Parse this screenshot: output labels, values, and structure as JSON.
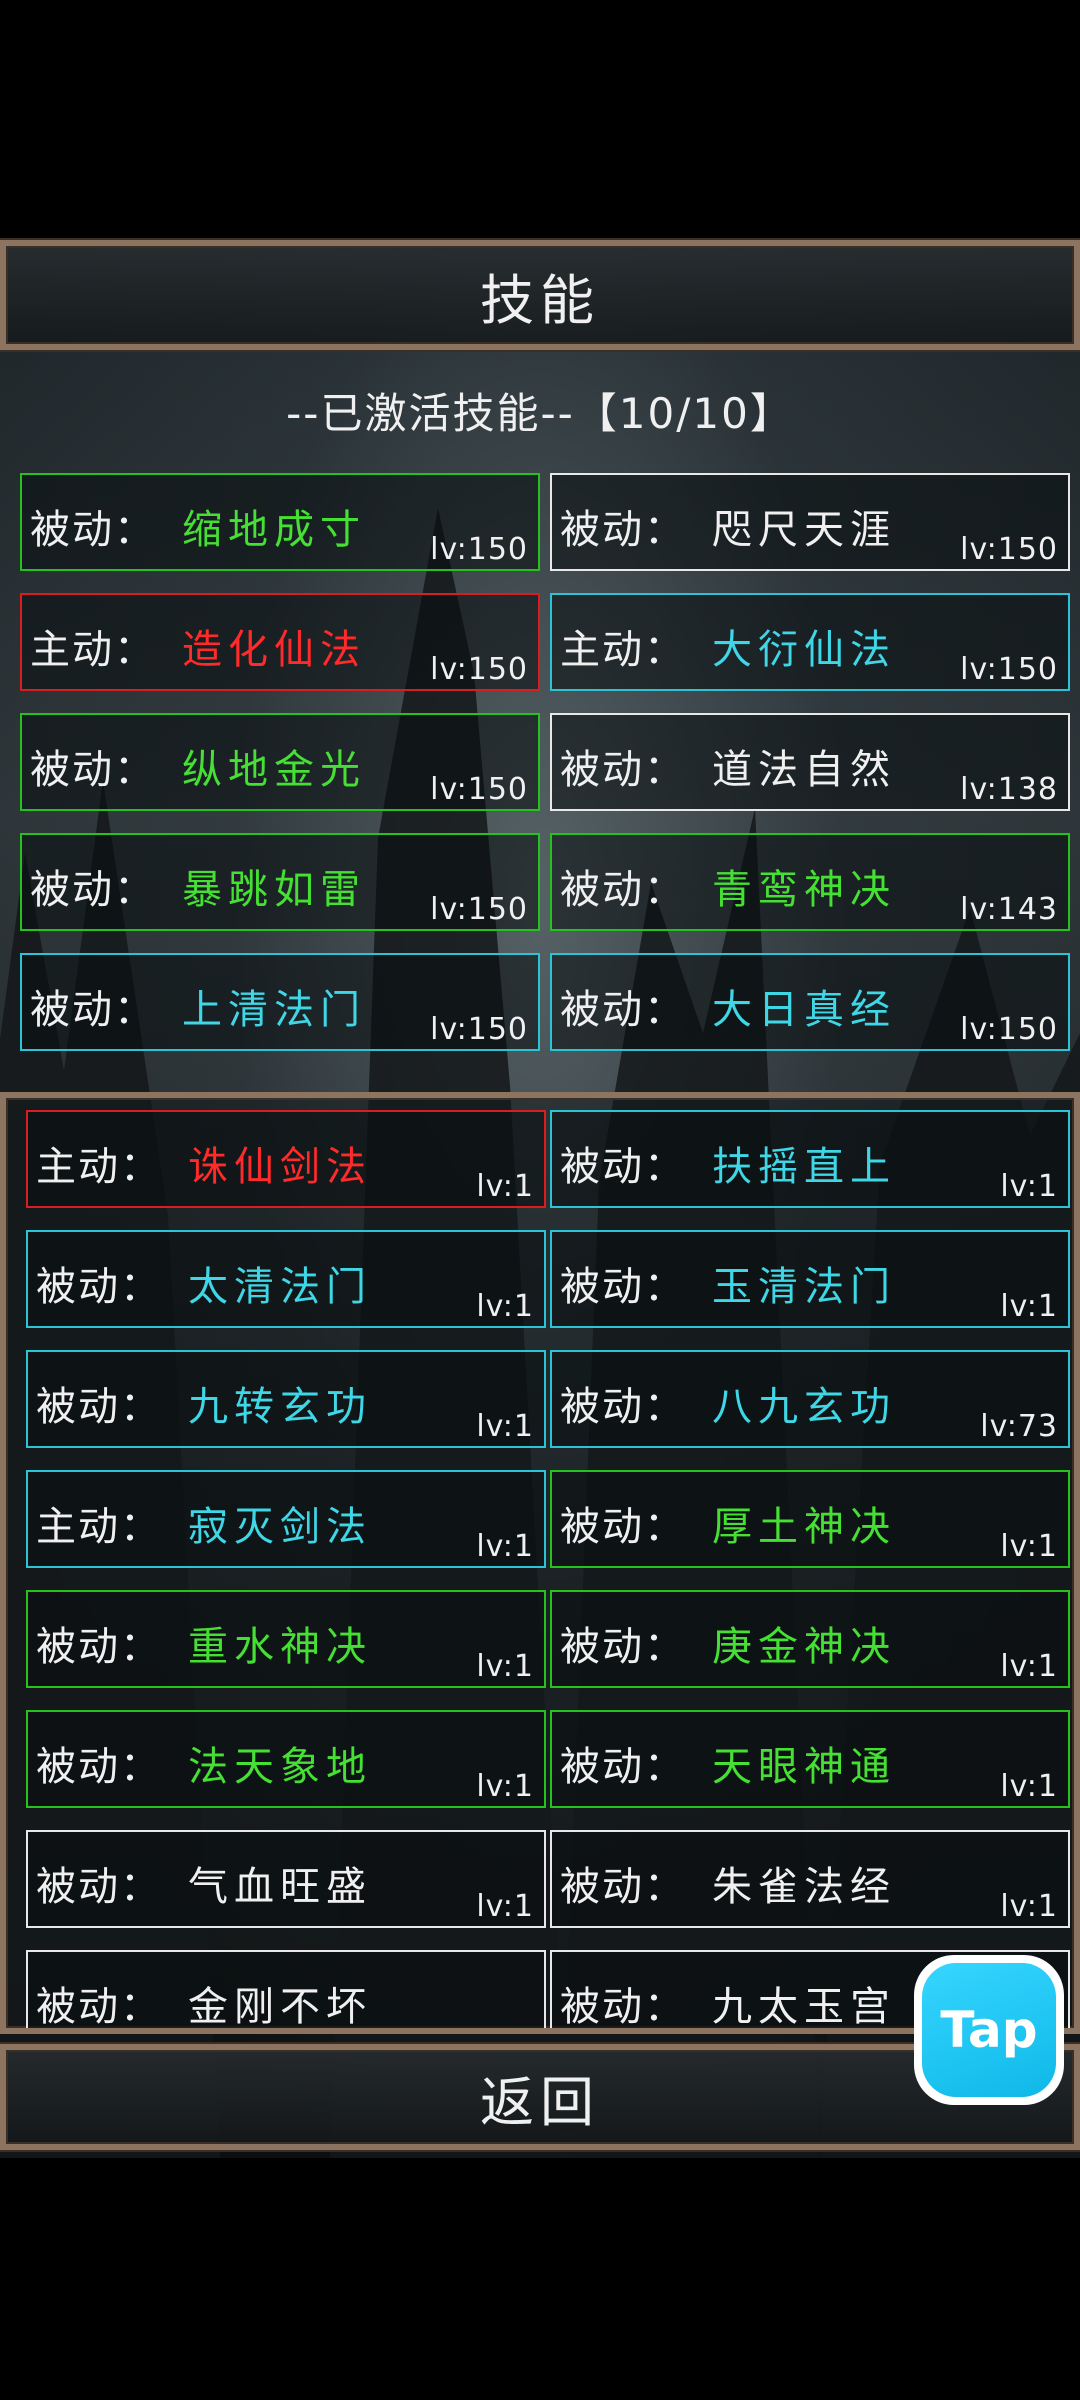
{
  "title": "技能",
  "active_header": "--已激活技能--【10/10】",
  "back_label": "返回",
  "tap_badge": "Tap",
  "active_skills": [
    {
      "type": "被动：",
      "name": "缩地成寸",
      "lv": "lv:150",
      "color": "green"
    },
    {
      "type": "被动：",
      "name": "咫尺天涯",
      "lv": "lv:150",
      "color": "white"
    },
    {
      "type": "主动：",
      "name": "造化仙法",
      "lv": "lv:150",
      "color": "red"
    },
    {
      "type": "主动：",
      "name": "大衍仙法",
      "lv": "lv:150",
      "color": "cyan"
    },
    {
      "type": "被动：",
      "name": "纵地金光",
      "lv": "lv:150",
      "color": "green"
    },
    {
      "type": "被动：",
      "name": "道法自然",
      "lv": "lv:138",
      "color": "white"
    },
    {
      "type": "被动：",
      "name": "暴跳如雷",
      "lv": "lv:150",
      "color": "green"
    },
    {
      "type": "被动：",
      "name": "青鸾神决",
      "lv": "lv:143",
      "color": "green"
    },
    {
      "type": "被动：",
      "name": "上清法门",
      "lv": "lv:150",
      "color": "cyan"
    },
    {
      "type": "被动：",
      "name": "大日真经",
      "lv": "lv:150",
      "color": "cyan"
    }
  ],
  "other_skills": [
    {
      "type": "主动：",
      "name": "诛仙剑法",
      "lv": "lv:1",
      "color": "red"
    },
    {
      "type": "被动：",
      "name": "扶摇直上",
      "lv": "lv:1",
      "color": "cyan"
    },
    {
      "type": "被动：",
      "name": "太清法门",
      "lv": "lv:1",
      "color": "cyan"
    },
    {
      "type": "被动：",
      "name": "玉清法门",
      "lv": "lv:1",
      "color": "cyan"
    },
    {
      "type": "被动：",
      "name": "九转玄功",
      "lv": "lv:1",
      "color": "cyan"
    },
    {
      "type": "被动：",
      "name": "八九玄功",
      "lv": "lv:73",
      "color": "cyan"
    },
    {
      "type": "主动：",
      "name": "寂灭剑法",
      "lv": "lv:1",
      "color": "cyan"
    },
    {
      "type": "被动：",
      "name": "厚土神决",
      "lv": "lv:1",
      "color": "green"
    },
    {
      "type": "被动：",
      "name": "重水神决",
      "lv": "lv:1",
      "color": "green"
    },
    {
      "type": "被动：",
      "name": "庚金神决",
      "lv": "lv:1",
      "color": "green"
    },
    {
      "type": "被动：",
      "name": "法天象地",
      "lv": "lv:1",
      "color": "green"
    },
    {
      "type": "被动：",
      "name": "天眼神通",
      "lv": "lv:1",
      "color": "green"
    },
    {
      "type": "被动：",
      "name": "气血旺盛",
      "lv": "lv:1",
      "color": "white"
    },
    {
      "type": "被动：",
      "name": "朱雀法经",
      "lv": "lv:1",
      "color": "white"
    },
    {
      "type": "被动：",
      "name": "金刚不坏",
      "lv": "",
      "color": "white"
    },
    {
      "type": "被动：",
      "name": "九太玉宫",
      "lv": "",
      "color": "white"
    }
  ]
}
